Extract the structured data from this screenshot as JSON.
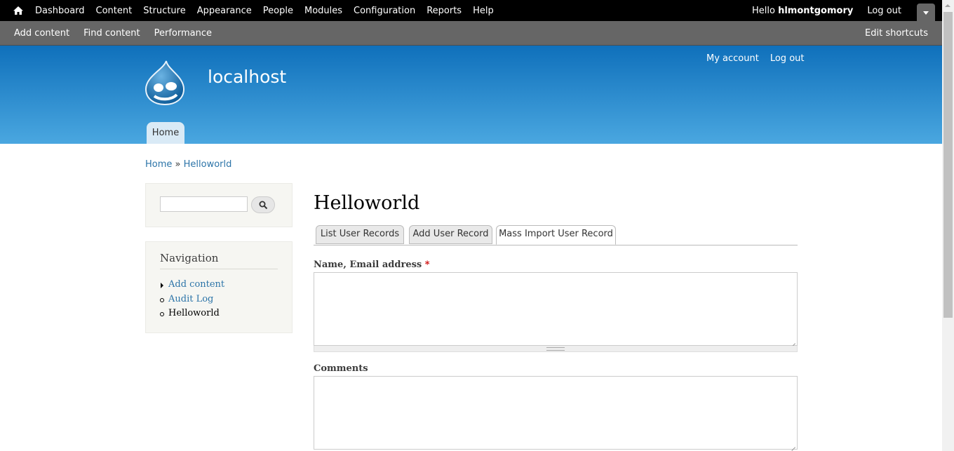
{
  "toolbar": {
    "menu": [
      "Dashboard",
      "Content",
      "Structure",
      "Appearance",
      "People",
      "Modules",
      "Configuration",
      "Reports",
      "Help"
    ],
    "hello": "Hello",
    "username": "hlmontgomory",
    "logout": "Log out"
  },
  "shortcuts": {
    "items": [
      "Add content",
      "Find content",
      "Performance"
    ],
    "edit": "Edit shortcuts"
  },
  "header": {
    "site_name": "localhost",
    "secondary": [
      "My account",
      "Log out"
    ],
    "main_tab": "Home"
  },
  "breadcrumb": {
    "home": "Home",
    "separator": "»",
    "current": "Helloworld"
  },
  "search": {
    "value": ""
  },
  "navigation": {
    "title": "Navigation",
    "items": [
      "Add content",
      "Audit Log",
      "Helloworld"
    ]
  },
  "content": {
    "title": "Helloworld",
    "tabs": [
      "List User Records",
      "Add User Record",
      "Mass Import User Record"
    ],
    "active_tab": "Mass Import User Record",
    "field1_label": "Name, Email address",
    "required_marker": "*",
    "field1_value": "",
    "field2_label": "Comments",
    "field2_value": ""
  },
  "colors": {
    "toolbar": "#000000",
    "shortcuts": "#666666",
    "header_top": "#0f70bb",
    "header_bottom": "#4aa7e0",
    "link": "#2c74a8"
  }
}
